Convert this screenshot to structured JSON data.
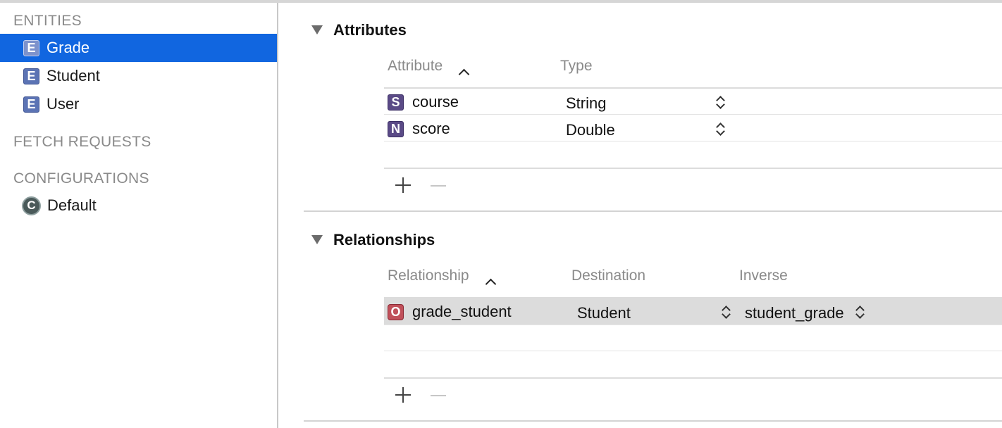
{
  "sidebar": {
    "entities_header": "ENTITIES",
    "entities": [
      {
        "label": "Grade",
        "icon": "E",
        "selected": true
      },
      {
        "label": "Student",
        "icon": "E",
        "selected": false
      },
      {
        "label": "User",
        "icon": "E",
        "selected": false
      }
    ],
    "fetch_requests_header": "FETCH REQUESTS",
    "configurations_header": "CONFIGURATIONS",
    "configurations": [
      {
        "label": "Default",
        "icon": "C"
      }
    ]
  },
  "attributes": {
    "title": "Attributes",
    "columns": [
      "Attribute",
      "Type"
    ],
    "rows": [
      {
        "icon": "S",
        "name": "course",
        "type": "String"
      },
      {
        "icon": "N",
        "name": "score",
        "type": "Double"
      }
    ]
  },
  "relationships": {
    "title": "Relationships",
    "columns": [
      "Relationship",
      "Destination",
      "Inverse"
    ],
    "rows": [
      {
        "icon": "O",
        "name": "grade_student",
        "destination": "Student",
        "inverse": "student_grade"
      }
    ]
  },
  "colors": {
    "selection": "#1166e0",
    "entity_badge": "#5b73b4",
    "attribute_badge": "#5a4a86",
    "relationship_badge": "#c0505a",
    "highlight_row": "#dcdcdc"
  },
  "icons": [
    "entity-icon",
    "configuration-icon",
    "disclosure-triangle-icon",
    "sort-ascending-icon",
    "stepper-icon",
    "add-icon",
    "remove-icon"
  ]
}
